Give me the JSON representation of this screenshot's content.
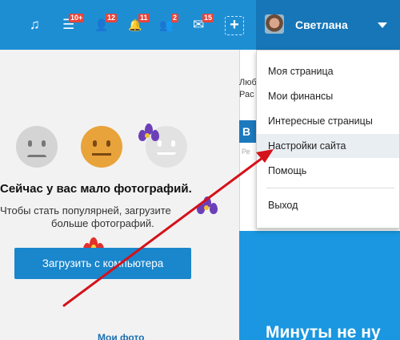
{
  "toolbar": {
    "icons": [
      {
        "name": "music-icon",
        "glyph": "♫",
        "badge": ""
      },
      {
        "name": "feed-icon",
        "glyph": "☰",
        "badge": "10+"
      },
      {
        "name": "guests-icon",
        "glyph": "👤",
        "badge": "12"
      },
      {
        "name": "notifications-icon",
        "glyph": "🔔",
        "badge": "11"
      },
      {
        "name": "friends-icon",
        "glyph": "👥",
        "badge": "2"
      },
      {
        "name": "messages-icon",
        "glyph": "✉",
        "badge": "15"
      }
    ],
    "plus_glyph": "+"
  },
  "user": {
    "name": "Светлана"
  },
  "dropdown": {
    "items": [
      {
        "label": "Моя страница"
      },
      {
        "label": "Мои финансы"
      },
      {
        "label": "Интересные страницы"
      },
      {
        "label": "Настройки сайта",
        "highlighted": true
      },
      {
        "label": "Помощь"
      },
      {
        "label": "Выход"
      }
    ]
  },
  "main": {
    "headline": "Сейчас у вас мало фотографий.",
    "subtext_line1": "Чтобы стать популярней, загрузите",
    "subtext_line2": "больше фотографий.",
    "upload_button": "Загрузить с компьютера",
    "bottom_text": "Мои фото"
  },
  "right_column": {
    "text1": "Люб",
    "text2": "Рас",
    "box_letter": "В",
    "small": "Ре",
    "banner_text": "Минуты не ну"
  },
  "colors": {
    "topbar": "#1e8ed3",
    "user_area": "#1676b7",
    "badge": "#e7443a",
    "button": "#1a86cc",
    "arrow": "#d4121b"
  }
}
